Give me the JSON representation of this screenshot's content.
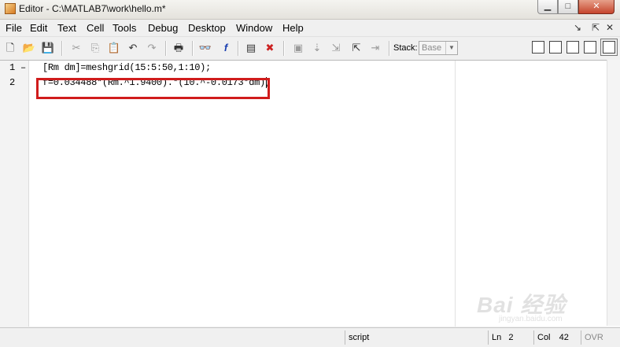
{
  "window": {
    "title": "Editor - C:\\MATLAB7\\work\\hello.m*",
    "min_glyph": "▁",
    "max_glyph": "□",
    "close_glyph": "✕"
  },
  "menu": {
    "items": [
      "File",
      "Edit",
      "Text",
      "Cell",
      "Tools",
      "Debug",
      "Desktop",
      "Window",
      "Help"
    ],
    "undock_glyph": "↘",
    "close_glyph": "✕"
  },
  "toolbar": {
    "stack_label": "Stack:",
    "stack_value": "Base",
    "stack_arrow": "▼",
    "icons": [
      "new-file",
      "open-folder",
      "save",
      "cut",
      "copy",
      "paste",
      "undo",
      "redo",
      "print",
      "find",
      "function",
      "show-dependencies",
      "clear-breakpoints",
      "set-breakpoint",
      "step",
      "step-in",
      "step-out",
      "continue",
      "exit-debug"
    ],
    "glyphs": {
      "new": "🗋",
      "open": "📂",
      "save": "💾",
      "cut": "✂",
      "copy": "⎘",
      "paste": "📋",
      "undo": "↶",
      "redo": "↷",
      "print": "🖶",
      "find": "👓",
      "func": "f",
      "dep": "▤",
      "clear": "✖",
      "bp": "▣",
      "step": "⇣",
      "stepin": "⇲",
      "stepout": "⇱",
      "cont": "⇥",
      "exit": "⇤"
    }
  },
  "editor": {
    "lines": [
      {
        "number": "1",
        "mark": "–",
        "code": "[Rm dm]=meshgrid(15:5:50,1:10);"
      },
      {
        "number": "2",
        "mark": "",
        "code": "f=0.034488*(Rm.^1.9400).*(10.^-0.0173*dm);"
      }
    ]
  },
  "status": {
    "mode": "script",
    "ln_label": "Ln",
    "ln_value": "2",
    "col_label": "Col",
    "col_value": "42",
    "ovr": "OVR"
  },
  "watermark": {
    "text": "Bai 经验",
    "sub": "jingyan.baidu.com"
  },
  "colors": {
    "highlight": "#d01c1c"
  }
}
